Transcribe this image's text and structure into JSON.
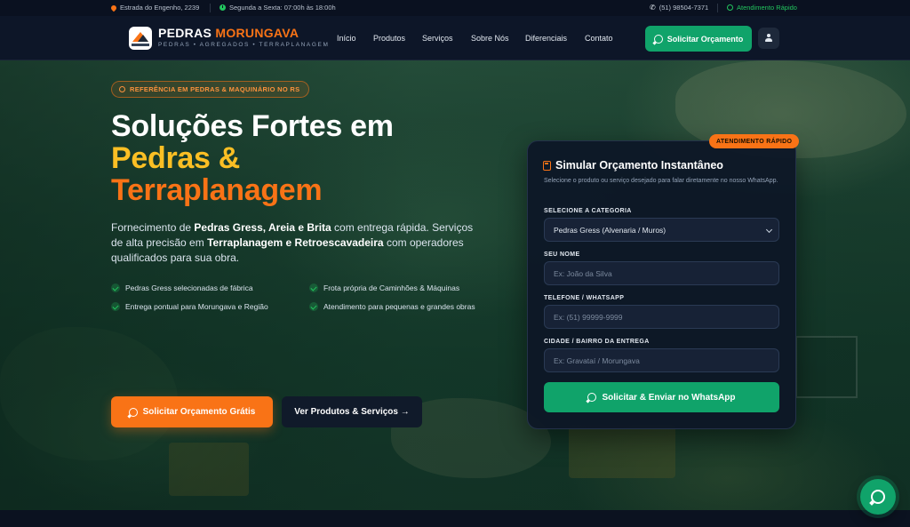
{
  "topbar": {
    "address": "Estrada do Engenho, 2239",
    "hours": "Segunda a Sexta: 07:00h às 18:00h",
    "phone": "(51) 98504-7371",
    "whatsapp": "Atendimento Rápido"
  },
  "nav": {
    "brand_part1": "PEDRAS",
    "brand_part2": "MORUNGAVA",
    "brand_sub": "PEDRAS • AGREGADOS • TERRAPLANAGEM",
    "links": [
      "Início",
      "Produtos",
      "Serviços",
      "Sobre Nós",
      "Diferenciais",
      "Contato"
    ],
    "cta": "Solicitar Orçamento"
  },
  "hero": {
    "badge": "REFERÊNCIA EM PEDRAS & MAQUINÁRIO NO RS",
    "title_line1": "Soluções Fortes em",
    "title_line2": "Pedras &",
    "title_line3": "Terraplanagem",
    "desc_1": "Fornecimento de ",
    "desc_b1": "Pedras Gress, Areia e Brita",
    "desc_2": " com entrega rápida. Serviços de alta precisão em ",
    "desc_b2": "Terraplanagem e Retroescavadeira",
    "desc_3": " com operadores qualificados para sua obra.",
    "features": [
      "Pedras Gress selecionadas de fábrica",
      "Frota própria de Caminhões & Máquinas",
      "Entrega pontual para Morungava e Região",
      "Atendimento para pequenas e grandes obras"
    ],
    "btn_primary": "Solicitar Orçamento Grátis",
    "btn_secondary": "Ver Produtos & Serviços →"
  },
  "form": {
    "tag": "ATENDIMENTO RÁPIDO",
    "title": "Simular Orçamento Instantâneo",
    "subtitle": "Selecione o produto ou serviço desejado para falar diretamente no nosso WhatsApp.",
    "category_label": "SELECIONE A CATEGORIA",
    "category_value": "Pedras Gress (Alvenaria / Muros)",
    "name_label": "SEU NOME",
    "name_placeholder": "Ex: João da Silva",
    "phone_label": "TELEFONE / WHATSAPP",
    "phone_placeholder": "Ex: (51) 99999-9999",
    "city_label": "CIDADE / BAIRRO DA ENTREGA",
    "city_placeholder": "Ex: Gravataí / Morungava",
    "submit": "Solicitar & Enviar no WhatsApp"
  },
  "colors": {
    "accent_orange": "#f97316",
    "accent_yellow": "#fbbf24",
    "whatsapp_green": "#10a36a",
    "navy": "#0d1628"
  },
  "icons": {
    "fab": "whatsapp-icon"
  }
}
